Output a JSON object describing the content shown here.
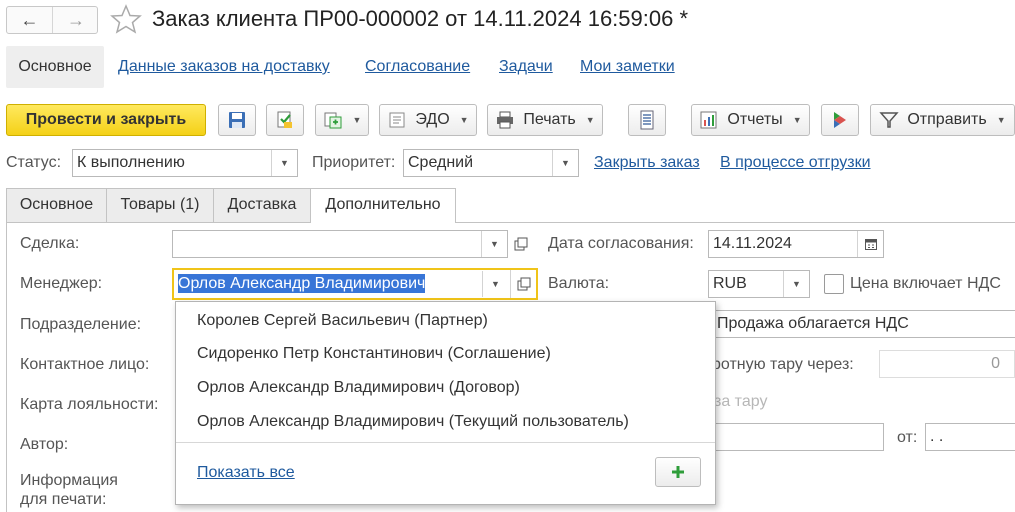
{
  "window": {
    "title": "Заказ клиента ПР00-000002 от 14.11.2024 16:59:06 *",
    "back_icon": "←",
    "forward_icon": "→",
    "favorite_icon": "star-icon"
  },
  "nav": {
    "tabs": [
      {
        "label": "Основное",
        "active": true
      },
      {
        "label": "Данные заказов на доставку"
      },
      {
        "label": "Согласование"
      },
      {
        "label": "Задачи"
      },
      {
        "label": "Мои заметки"
      }
    ]
  },
  "toolbar": {
    "post_close_label": "Провести и закрыть",
    "edo_label": "ЭДО",
    "print_label": "Печать",
    "reports_label": "Отчеты",
    "send_label": "Отправить"
  },
  "status_row": {
    "status_label": "Статус:",
    "status_value": "К выполнению",
    "priority_label": "Приоритет:",
    "priority_value": "Средний",
    "close_order_link": "Закрыть заказ",
    "shipping_link": "В процессе отгрузки"
  },
  "page_tabs": [
    {
      "label": "Основное"
    },
    {
      "label": "Товары (1)"
    },
    {
      "label": "Доставка"
    },
    {
      "label": "Дополнительно",
      "active": true
    }
  ],
  "form": {
    "deal_label": "Сделка:",
    "deal_value": "",
    "manager_label": "Менеджер:",
    "manager_value": "Орлов Александр Владимирович",
    "department_label": "Подразделение:",
    "contact_label": "Контактное лицо:",
    "loyalty_label": "Карта лояльности:",
    "author_label": "Автор:",
    "print_info_label_1": "Информация",
    "print_info_label_2": "для печати:",
    "approval_date_label": "Дата согласования:",
    "approval_date_value": "14.11.2024",
    "currency_label": "Валюта:",
    "currency_value": "RUB",
    "vat_included_label": "Цена включает НДС",
    "vat_included_checked": false,
    "sale_vat_value": "Продажа облагается НДС",
    "return_tare_label_partial": "ротную тару через:",
    "return_tare_value": "0",
    "tare_label_partial": "за тару",
    "from_label": "от:",
    "from_value": " .  ."
  },
  "dropdown": {
    "items": [
      "Королев Сергей Васильевич (Партнер)",
      "Сидоренко Петр Константинович (Соглашение)",
      "Орлов Александр Владимирович (Договор)",
      "Орлов Александр Владимирович (Текущий пользователь)"
    ],
    "show_all_label": "Показать все"
  },
  "colors": {
    "accent_link": "#1f5a9e",
    "primary_button": "#f4d117",
    "selection": "#3875d7",
    "focus_border": "#f0c419"
  }
}
